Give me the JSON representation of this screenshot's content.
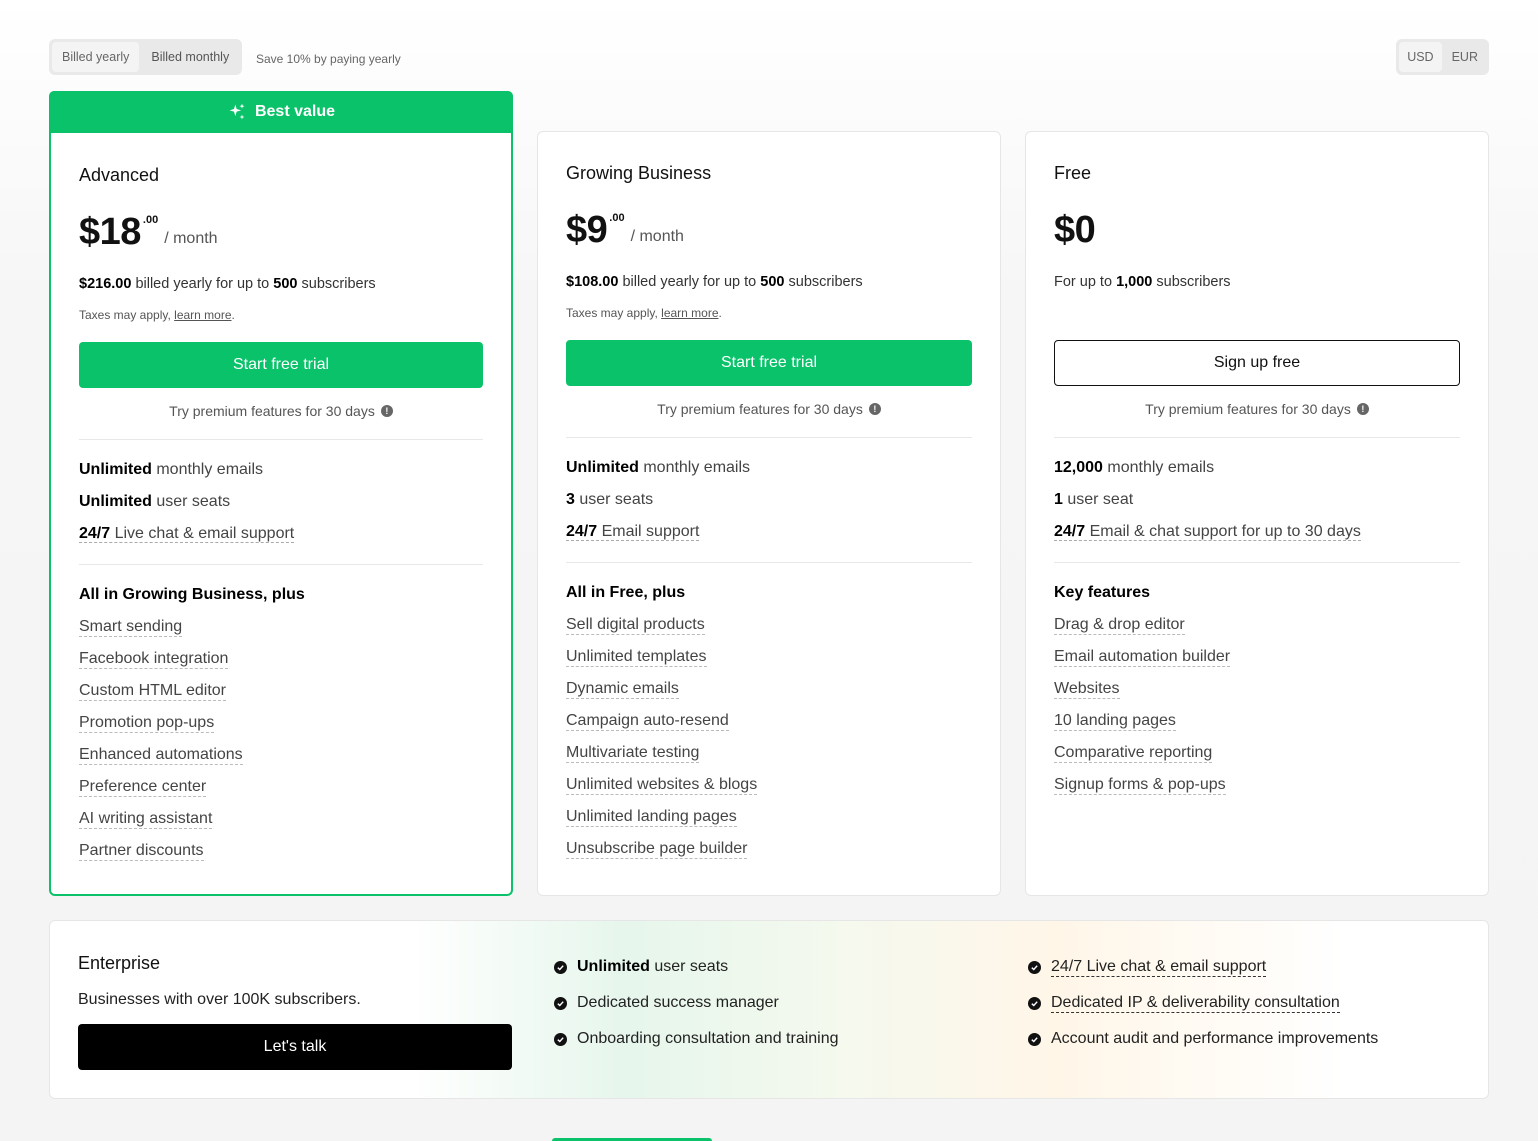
{
  "billing": {
    "yearly_label": "Billed yearly",
    "monthly_label": "Billed monthly",
    "save_note": "Save 10% by paying yearly"
  },
  "currency": {
    "usd": "USD",
    "eur": "EUR"
  },
  "colors": {
    "accent": "#09c269",
    "black": "#000000"
  },
  "plans": [
    {
      "banner": "Best value",
      "name": "Advanced",
      "price": "$18",
      "cents": ".00",
      "per": "/ month",
      "billed_amount": "$216.00",
      "billed_text": " billed yearly for up to ",
      "subscribers": "500",
      "subscribers_suffix": " subscribers",
      "taxes_text": "Taxes may apply, ",
      "taxes_link": "learn more",
      "taxes_end": ".",
      "cta": "Start free trial",
      "premium_note": "Try premium features for 30 days",
      "features": [
        {
          "bold": "Unlimited",
          "rest": " monthly emails"
        },
        {
          "bold": "Unlimited",
          "rest": " user seats"
        },
        {
          "bold": "24/7",
          "rest": " Live chat & email support"
        }
      ],
      "section_title": "All in Growing Business, plus",
      "items": [
        "Smart sending",
        "Facebook integration",
        "Custom HTML editor",
        "Promotion pop-ups",
        "Enhanced automations",
        "Preference center",
        "AI writing assistant",
        "Partner discounts"
      ]
    },
    {
      "name": "Growing Business",
      "price": "$9",
      "cents": ".00",
      "per": "/ month",
      "billed_amount": "$108.00",
      "billed_text": " billed yearly for up to ",
      "subscribers": "500",
      "subscribers_suffix": " subscribers",
      "taxes_text": "Taxes may apply, ",
      "taxes_link": "learn more",
      "taxes_end": ".",
      "cta": "Start free trial",
      "premium_note": "Try premium features for 30 days",
      "features": [
        {
          "bold": "Unlimited",
          "rest": " monthly emails"
        },
        {
          "bold": "3",
          "rest": " user seats"
        },
        {
          "bold": "24/7",
          "rest": " Email support"
        }
      ],
      "section_title": "All in Free, plus",
      "items": [
        "Sell digital products",
        "Unlimited templates",
        "Dynamic emails",
        "Campaign auto-resend",
        "Multivariate testing",
        "Unlimited websites & blogs",
        "Unlimited landing pages",
        "Unsubscribe page builder"
      ]
    },
    {
      "name": "Free",
      "price": "$0",
      "for_text": "For up to ",
      "subscribers": "1,000",
      "subscribers_suffix": " subscribers",
      "cta": "Sign up free",
      "premium_note": "Try premium features for 30 days",
      "features": [
        {
          "bold": "12,000",
          "rest": " monthly emails"
        },
        {
          "bold": "1",
          "rest": " user seat"
        },
        {
          "bold": "24/7",
          "rest": " Email & chat support for up to 30 days"
        }
      ],
      "section_title": "Key features",
      "items": [
        "Drag & drop editor",
        "Email automation builder",
        "Websites",
        "10 landing pages",
        "Comparative reporting",
        "Signup forms & pop-ups"
      ]
    }
  ],
  "enterprise": {
    "title": "Enterprise",
    "subtitle": "Businesses with over 100K subscribers.",
    "cta": "Let's talk",
    "col1": [
      {
        "bold": "Unlimited",
        "rest": " user seats"
      },
      {
        "bold": "",
        "rest": "Dedicated success manager"
      },
      {
        "bold": "",
        "rest": "Onboarding consultation and training"
      }
    ],
    "col2": [
      {
        "dashed": "24/7 Live chat & email support"
      },
      {
        "dashed": "Dedicated IP & deliverability consultation"
      },
      {
        "plain": "Account audit and performance improvements"
      }
    ]
  }
}
